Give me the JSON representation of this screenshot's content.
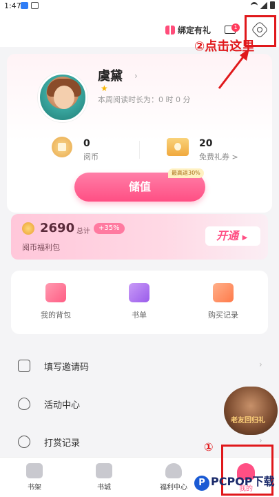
{
  "status_bar": {
    "time": "1:47"
  },
  "top_bar": {
    "bind_gift_label": "绑定有礼",
    "mail_badge": "1"
  },
  "profile": {
    "username": "虞黛",
    "weekly_reading": "本周阅读时长为：0 时 0 分",
    "coins_value": "0",
    "coins_label": "阅币",
    "tickets_value": "20",
    "tickets_label": "免费礼券 >",
    "recharge_label": "储值",
    "max_tag": "最高返30%"
  },
  "annotations": {
    "click_here": "②点击这里",
    "step_one": "①"
  },
  "vip": {
    "amount": "2690",
    "total_label": "总计",
    "percent": "+35%",
    "subtitle": "阅币福利包",
    "open_label": "开通"
  },
  "actions": [
    {
      "label": "我的背包",
      "color": "#ff6f8e"
    },
    {
      "label": "书单",
      "color": "#a86cf0"
    },
    {
      "label": "购买记录",
      "color": "#ff8a5c"
    }
  ],
  "list": [
    {
      "label": "填写邀请码",
      "icon": "edit-icon"
    },
    {
      "label": "活动中心",
      "icon": "flame-icon"
    },
    {
      "label": "打赏记录",
      "icon": "coins-stack-icon"
    }
  ],
  "promo": {
    "text": "老友回归礼"
  },
  "bottom_nav": [
    {
      "label": "书架",
      "icon": "bookshelf-icon"
    },
    {
      "label": "书城",
      "icon": "bookstore-icon"
    },
    {
      "label": "福利中心",
      "icon": "welfare-bag-icon"
    },
    {
      "label": "我的",
      "icon": "me-icon"
    }
  ],
  "watermark": "PCPOP下载",
  "colors": {
    "accent": "#ff4f84",
    "annotation_red": "#e0181b"
  }
}
